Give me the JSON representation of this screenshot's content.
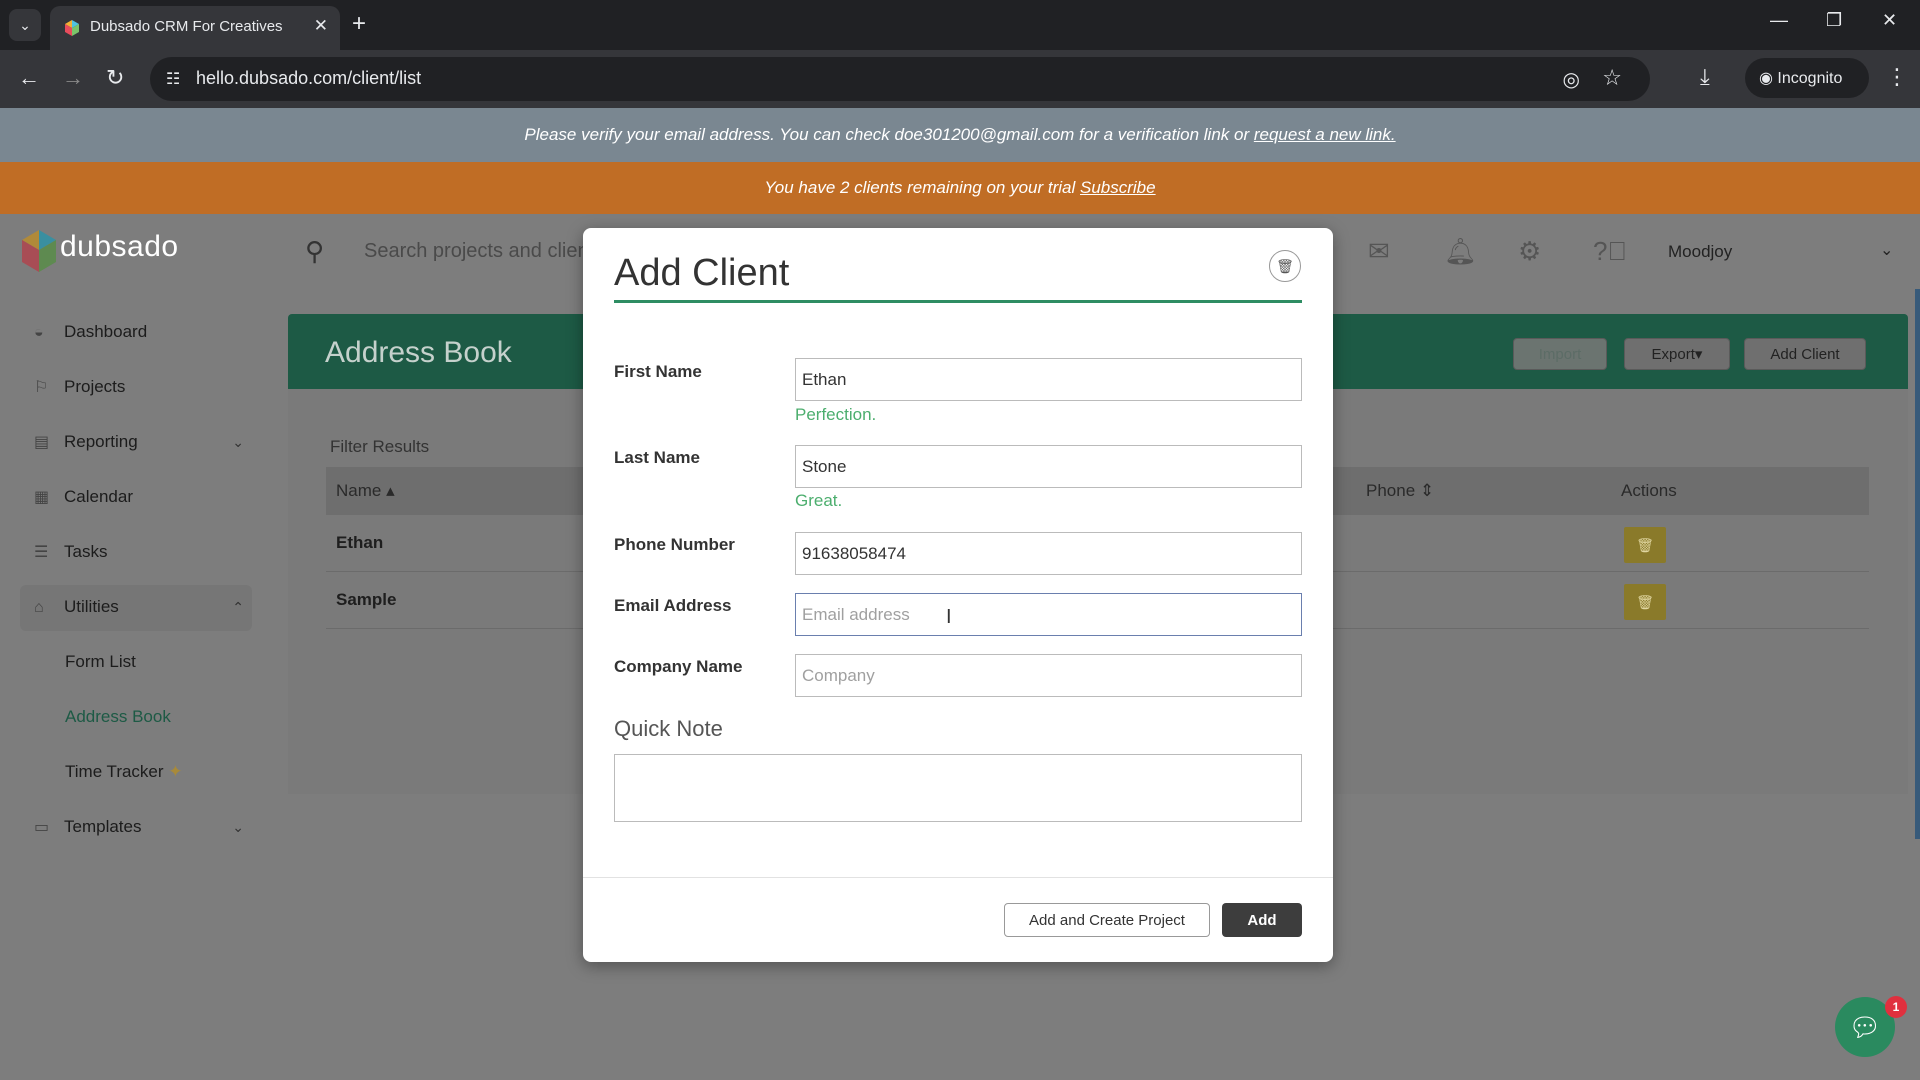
{
  "browser": {
    "tab_title": "Dubsado CRM For Creatives",
    "url": "hello.dubsado.com/client/list",
    "incognito_label": "Incognito"
  },
  "banners": {
    "verify_text": "Please verify your email address. You can check doe301200@gmail.com for a verification link or ",
    "verify_link": "request a new link.",
    "trial_text": "You have 2 clients remaining on your trial ",
    "trial_link": "Subscribe"
  },
  "header": {
    "logo_text": "dubsado",
    "search_placeholder": "Search projects and clients",
    "user_name": "Moodjoy"
  },
  "sidebar": {
    "items": [
      {
        "label": "Dashboard"
      },
      {
        "label": "Projects"
      },
      {
        "label": "Reporting"
      },
      {
        "label": "Calendar"
      },
      {
        "label": "Tasks"
      },
      {
        "label": "Utilities"
      },
      {
        "label": "Form List"
      },
      {
        "label": "Address Book"
      },
      {
        "label": "Time Tracker"
      },
      {
        "label": "Templates"
      }
    ]
  },
  "address_book": {
    "title": "Address Book",
    "buttons": {
      "import": "Import",
      "export": "Export",
      "add_client": "Add Client"
    },
    "filter_label": "Filter Results",
    "columns": {
      "name": "Name",
      "phone": "Phone",
      "actions": "Actions"
    },
    "rows": [
      {
        "name": "Ethan"
      },
      {
        "name": "Sample"
      }
    ]
  },
  "modal": {
    "title": "Add Client",
    "fields": {
      "first_name": {
        "label": "First Name",
        "value": "Ethan",
        "hint": "Perfection."
      },
      "last_name": {
        "label": "Last Name",
        "value": "Stone",
        "hint": "Great."
      },
      "phone": {
        "label": "Phone Number",
        "value": "91638058474"
      },
      "email": {
        "label": "Email Address",
        "placeholder": "Email address"
      },
      "company": {
        "label": "Company Name",
        "placeholder": "Company"
      }
    },
    "quick_note_label": "Quick Note",
    "buttons": {
      "add_and_create": "Add and Create Project",
      "add": "Add"
    }
  },
  "chat": {
    "badge_count": "1"
  },
  "colors": {
    "brand_green": "#1d5a45",
    "trial_orange": "#c06d25",
    "hint_green": "#4cae6e"
  }
}
